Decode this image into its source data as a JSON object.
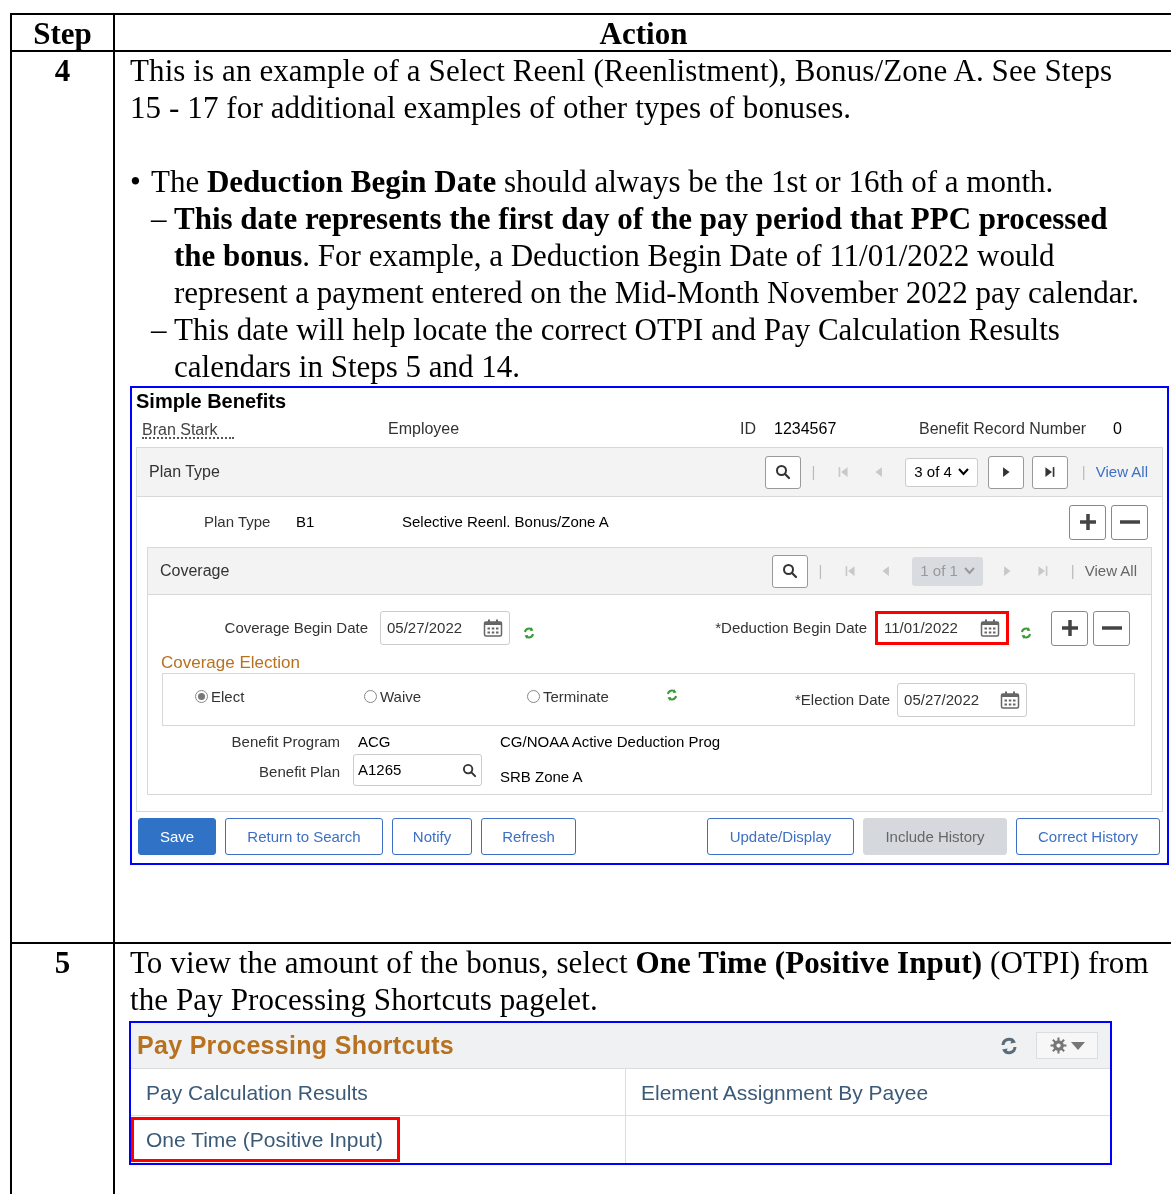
{
  "table": {
    "columns": [
      "Step",
      "Action"
    ],
    "rows": [
      {
        "step": "4",
        "intro": "This is an example of a Select Reenl (Reenlistment), Bonus/Zone A. See Steps 15 - 17 for additional examples of other types of bonuses.",
        "bullets": [
          {
            "marker": "•",
            "text": "The **Deduction Begin Date** should always be the 1st or 16th of a month.",
            "children": [
              {
                "marker": "–",
                "text": "**This date represents the first day of the pay period that PPC processed the bonus**. For example, a Deduction Begin Date of 11/01/2022 would represent a payment entered on the Mid-Month November 2022 pay calendar."
              },
              {
                "marker": "–",
                "text": "This date will help locate the correct OTPI and Pay Calculation Results calendars in Steps 5 and 14."
              }
            ]
          }
        ],
        "benefits": {
          "title": "Simple Benefits",
          "employee_name": "Bran Stark",
          "employee_role": "Employee",
          "id_label": "ID",
          "id_value": "1234567",
          "record_label": "Benefit Record Number",
          "record_value": "0",
          "plan_bar": {
            "title": "Plan Type",
            "separator": "|",
            "page": "3 of 4",
            "page_disabled": false,
            "nav": [
              {
                "kind": "first",
                "disabled": true
              },
              {
                "kind": "prev",
                "disabled": true
              },
              {
                "kind": "next",
                "disabled": false
              },
              {
                "kind": "last",
                "disabled": false
              }
            ],
            "view_all": {
              "label": "View All",
              "disabled": false
            }
          },
          "plan_type": {
            "label": "Plan Type",
            "code": "B1",
            "description": "Selective Reenl. Bonus/Zone A"
          },
          "coverage_bar": {
            "title": "Coverage",
            "separator": "|",
            "page": "1 of 1",
            "page_disabled": true,
            "nav": [
              {
                "kind": "first",
                "disabled": true
              },
              {
                "kind": "prev",
                "disabled": true
              },
              {
                "kind": "next",
                "disabled": true
              },
              {
                "kind": "last",
                "disabled": true
              }
            ],
            "view_all": {
              "label": "View All",
              "disabled": true
            }
          },
          "coverage_begin": {
            "label": "Coverage Begin Date",
            "value": "05/27/2022",
            "highlighted": false
          },
          "deduction_begin": {
            "label": "*Deduction Begin Date",
            "value": "11/01/2022",
            "highlighted": true
          },
          "election_title": "Coverage Election",
          "election_options": [
            {
              "label": "Elect",
              "selected": true
            },
            {
              "label": "Waive",
              "selected": false
            },
            {
              "label": "Terminate",
              "selected": false
            }
          ],
          "election_date": {
            "label": "*Election Date",
            "value": "05/27/2022"
          },
          "benefit_program": {
            "label": "Benefit Program",
            "code": "ACG",
            "description": "CG/NOAA Active Deduction Prog"
          },
          "benefit_plan": {
            "label": "Benefit Plan",
            "value": "A1265",
            "description": "SRB Zone A"
          },
          "buttons": [
            {
              "label": "Save",
              "kind": "primary"
            },
            {
              "label": "Return to Search",
              "kind": "secondary"
            },
            {
              "label": "Notify",
              "kind": "secondary"
            },
            {
              "label": "Refresh",
              "kind": "secondary"
            },
            {
              "label": "Update/Display",
              "kind": "secondary"
            },
            {
              "label": "Include History",
              "kind": "disabled"
            },
            {
              "label": "Correct History",
              "kind": "secondary"
            }
          ]
        }
      },
      {
        "step": "5",
        "intro": "To view the amount of the bonus, select **One Time (Positive Input)** (OTPI) from the Pay Processing Shortcuts pagelet.",
        "shortcuts": {
          "title": "Pay Processing Shortcuts",
          "links": [
            {
              "label": "Pay Calculation Results",
              "highlighted": false
            },
            {
              "label": "Element Assignment By Payee",
              "highlighted": false
            },
            {
              "label": "One Time (Positive Input)",
              "highlighted": true
            }
          ]
        }
      }
    ]
  }
}
